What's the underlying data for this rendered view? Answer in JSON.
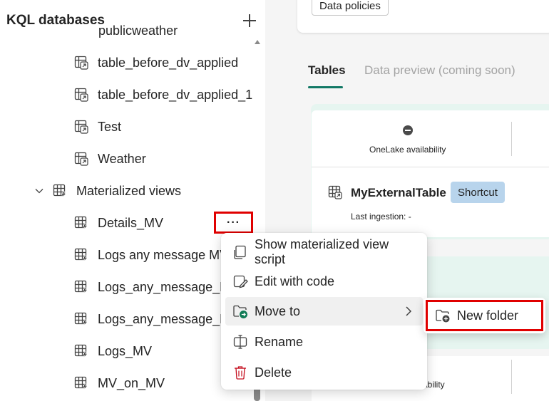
{
  "explorer": {
    "title": "KQL databases",
    "add_label": "+",
    "clipped_item": "publicweather",
    "tables": [
      {
        "label": "table_before_dv_applied"
      },
      {
        "label": "table_before_dv_applied_1"
      },
      {
        "label": "Test"
      },
      {
        "label": "Weather"
      }
    ],
    "materialized_group": {
      "label": "Materialized views",
      "expanded": true
    },
    "materialized_views": [
      {
        "label": "Details_MV"
      },
      {
        "label": "Logs any message MV"
      },
      {
        "label": "Logs_any_message_MV"
      },
      {
        "label": "Logs_any_message_MV"
      },
      {
        "label": "Logs_MV"
      },
      {
        "label": "MV_on_MV"
      }
    ],
    "more_button_label": "···"
  },
  "workspace": {
    "data_policies_label": "Data policies",
    "tabs": [
      {
        "label": "Tables",
        "active": true
      },
      {
        "label": "Data preview (coming soon)",
        "active": false
      }
    ],
    "onelake_label": "OneLake availability",
    "table_card": {
      "name": "MyExternalTable",
      "badge": "Shortcut",
      "last_ingestion": "Last ingestion: -"
    },
    "partial_availability_label": "ability"
  },
  "context_menu": {
    "items": [
      {
        "label": "Show materialized view script",
        "icon": "script-icon"
      },
      {
        "label": "Edit with code",
        "icon": "edit-code-icon"
      },
      {
        "label": "Move to",
        "icon": "move-folder-icon",
        "has_submenu": true
      },
      {
        "label": "Rename",
        "icon": "rename-icon"
      },
      {
        "label": "Delete",
        "icon": "delete-icon"
      }
    ],
    "submenu": {
      "new_folder_label": "New folder",
      "icon": "new-folder-icon"
    }
  },
  "colors": {
    "highlight_border": "#e00000",
    "tab_accent": "#117865",
    "badge_bg": "#b8d4ec",
    "delete_icon": "#c50f1f",
    "move_icon": "#0f7b55"
  }
}
